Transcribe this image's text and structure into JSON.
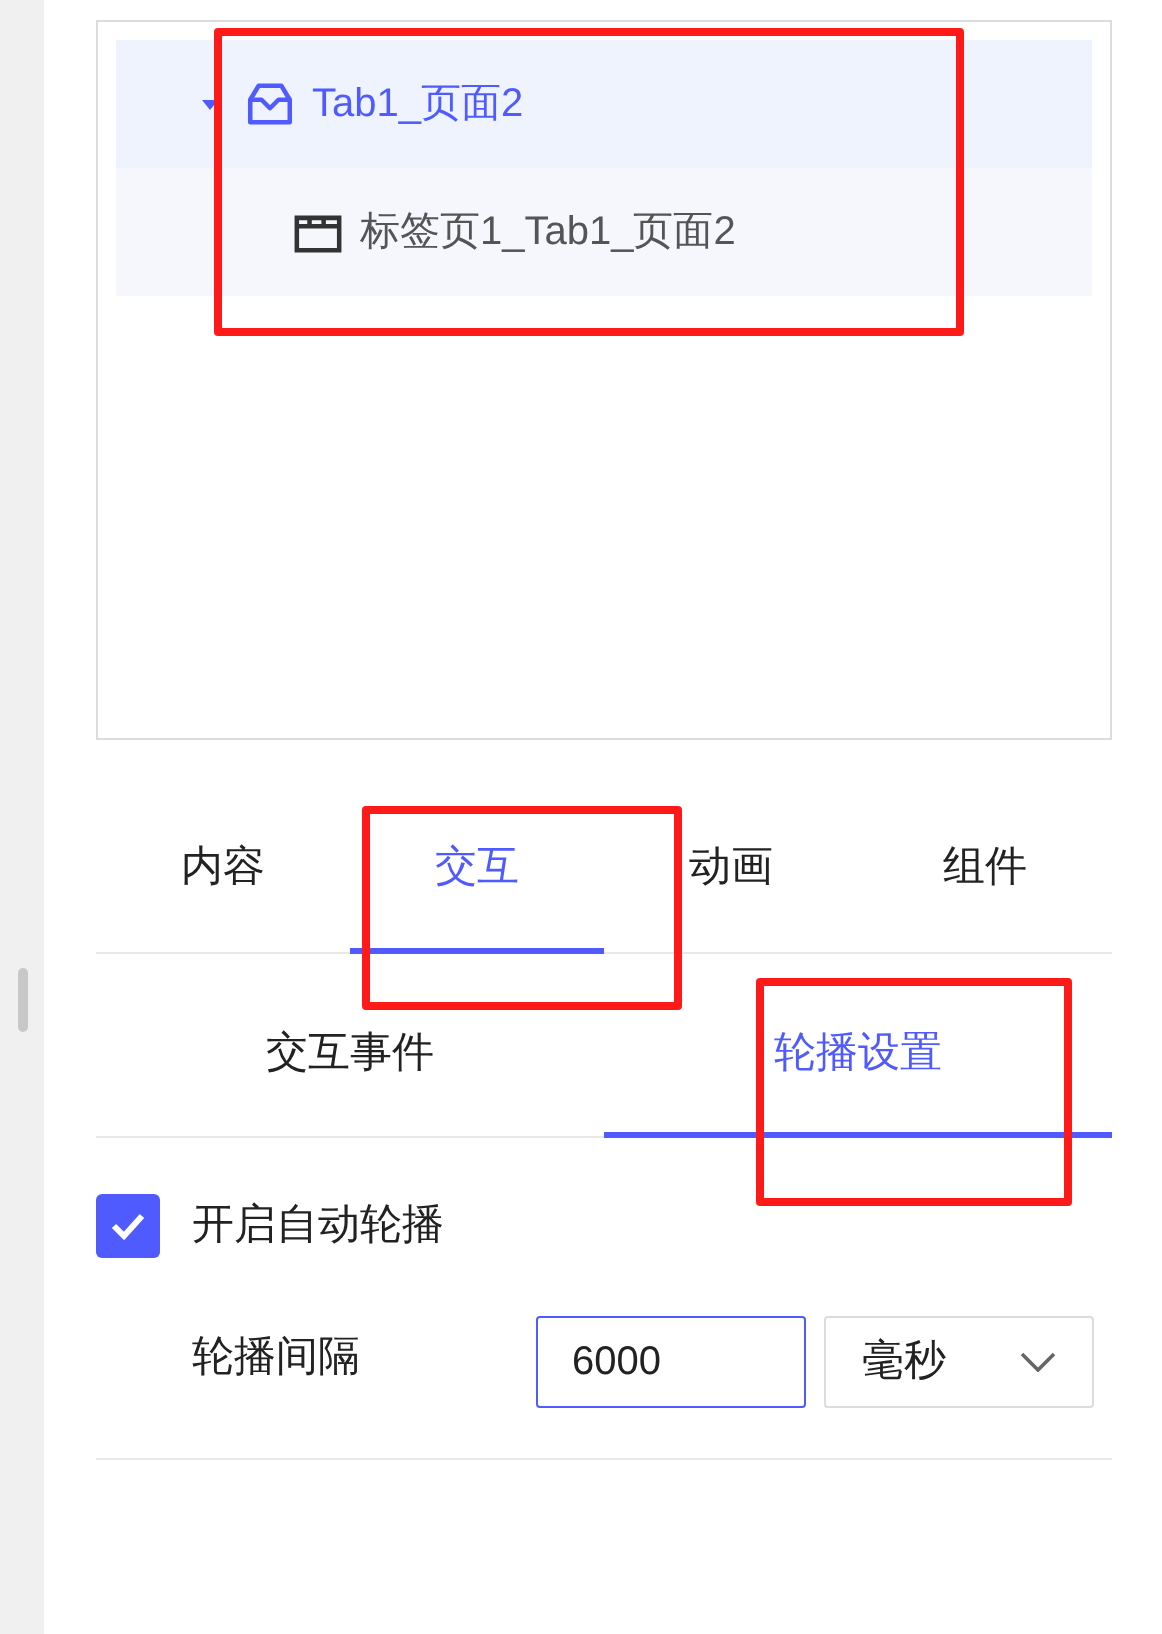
{
  "tree": [
    {
      "label": "Tab1_页面2",
      "expanded": true,
      "selected": true,
      "kind": "page",
      "children": [
        {
          "label": "标签页1_Tab1_页面2",
          "selected": false,
          "kind": "tab"
        }
      ]
    }
  ],
  "tabs": [
    {
      "label": "内容",
      "selected": false
    },
    {
      "label": "交互",
      "selected": true
    },
    {
      "label": "动画",
      "selected": false
    },
    {
      "label": "组件",
      "selected": false
    }
  ],
  "subtabs": [
    {
      "label": "交互事件",
      "selected": false
    },
    {
      "label": "轮播设置",
      "selected": true
    }
  ],
  "autoplay": {
    "label": "开启自动轮播",
    "checked": true
  },
  "interval": {
    "label": "轮播间隔",
    "value": "6000",
    "unit": "毫秒"
  }
}
